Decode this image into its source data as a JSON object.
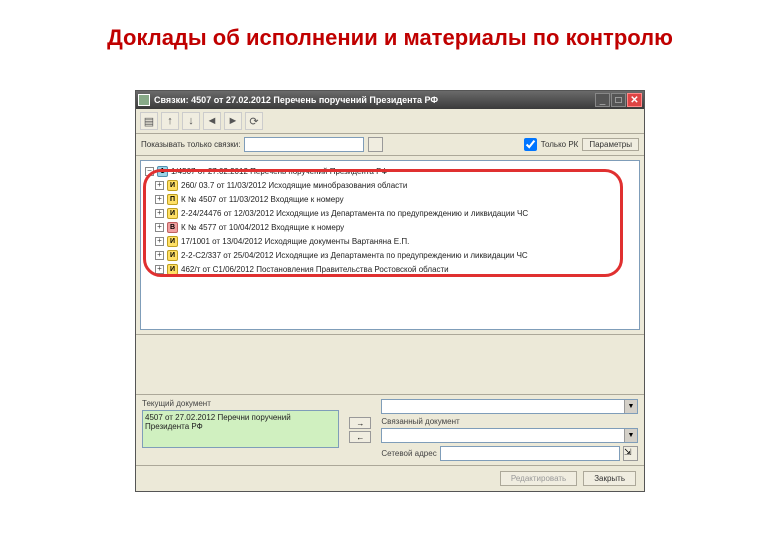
{
  "slide": {
    "title": "Доклады об исполнении и материалы по контролю"
  },
  "window": {
    "title": "Связки: 4507 от 27.02.2012 Перечень поручений Президента РФ"
  },
  "filter": {
    "label": "Показывать только связки:",
    "checkbox": "Только РК",
    "refresh": "Параметры"
  },
  "tree": {
    "root": "1/4507 от 27.02.2012 Перечень поручений Президента РФ",
    "rows": [
      {
        "tag": "И",
        "cls": "y",
        "text": "260/ 03.7 от 11/03/2012 Исходящие минобразования области"
      },
      {
        "tag": "П",
        "cls": "y",
        "text": "К № 4507 от 11/03/2012 Входящие к номеру"
      },
      {
        "tag": "И",
        "cls": "y",
        "text": "2-24/24476 от 12/03/2012 Исходящие из Департамента по предупреждению и ликвидации ЧС"
      },
      {
        "tag": "В",
        "cls": "r",
        "text": "К № 4577 от 10/04/2012 Входящие к номеру"
      },
      {
        "tag": "И",
        "cls": "y",
        "text": "17/1001 от 13/04/2012 Исходящие документы Вартаняна Е.П."
      },
      {
        "tag": "И",
        "cls": "y",
        "text": "2-2-С2/337 от 25/04/2012 Исходящие из Департамента по предупреждению и ликвидации ЧС"
      },
      {
        "tag": "И",
        "cls": "y",
        "text": "462/т от С1/06/2012 Постановления Правительства Ростовской области"
      }
    ]
  },
  "bottom": {
    "current_label": "Текущий документ",
    "current_text": "4507 от 27.02.2012 Перечни поручений Президента РФ",
    "linked_label": "Связанный документ",
    "addr_label": "Сетевой адрес"
  },
  "footer": {
    "edit": "Редактировать",
    "close": "Закрыть"
  }
}
